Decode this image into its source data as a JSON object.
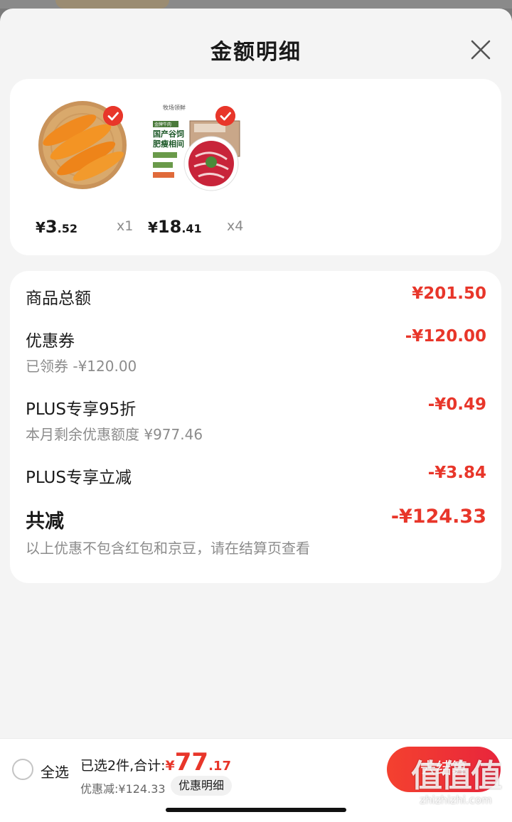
{
  "sheet": {
    "title": "金额明细"
  },
  "products": [
    {
      "yen": "¥",
      "price_int": "3",
      "price_dec": ".52",
      "qty": "x1",
      "checked": true
    },
    {
      "yen": "¥",
      "price_int": "18",
      "price_dec": ".41",
      "qty": "x4",
      "checked": true,
      "package_text": {
        "brand": "牧场领鲜",
        "tag": "金牌牛肉",
        "headline_1": "国产谷饲",
        "headline_2": "肥瘦相间"
      }
    }
  ],
  "details": {
    "goods_total": {
      "label": "商品总额",
      "value": "¥201.50"
    },
    "coupon": {
      "label": "优惠券",
      "value": "-¥120.00",
      "sub": "已领券 -¥120.00"
    },
    "plus_discount": {
      "label": "PLUS专享95折",
      "value": "-¥0.49",
      "sub": "本月剩余优惠额度 ¥977.46"
    },
    "plus_reduce": {
      "label": "PLUS专享立减",
      "value": "-¥3.84"
    },
    "total_reduce": {
      "label": "共减",
      "value": "-¥124.33",
      "sub": "以上优惠不包含红包和京豆，请在结算页查看"
    }
  },
  "bottom_bar": {
    "select_all": "全选",
    "selected_text": "已选2件,合计:",
    "yen": "¥",
    "total_big": "77",
    "total_small": ".17",
    "discount_text": "优惠减:¥124.33",
    "detail_button": "优惠明细",
    "checkout_button": "去结算"
  },
  "watermark": {
    "logo_text": "值值值",
    "domain": "zhizhizhi.com"
  },
  "colors": {
    "accent_red": "#e8362a",
    "sheet_bg": "#f4f4f4",
    "card_bg": "#ffffff"
  }
}
